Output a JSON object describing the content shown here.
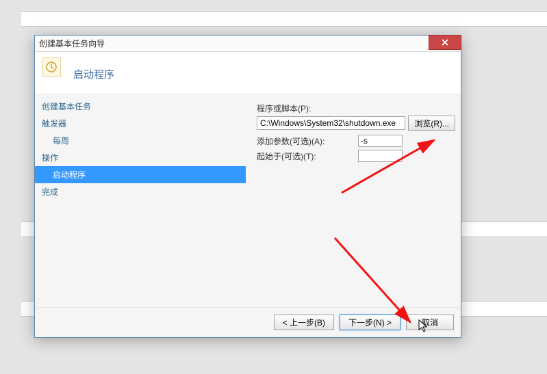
{
  "bg_bars": true,
  "dialog": {
    "title": "创建基本任务向导",
    "header_title": "启动程序",
    "close_btn": "×"
  },
  "sidebar": {
    "items": [
      {
        "label": "创建基本任务",
        "indent": false
      },
      {
        "label": "触发器",
        "indent": false
      },
      {
        "label": "每周",
        "indent": true
      },
      {
        "label": "操作",
        "indent": false
      },
      {
        "label": "启动程序",
        "indent": true,
        "selected": true
      },
      {
        "label": "完成",
        "indent": false
      }
    ]
  },
  "form": {
    "script_label": "程序或脚本(P):",
    "script_value": "C:\\Windows\\System32\\shutdown.exe",
    "browse_label": "浏览(R)...",
    "args_label": "添加参数(可选)(A):",
    "args_value": "-s",
    "startin_label": "起始于(可选)(T):",
    "startin_value": ""
  },
  "footer": {
    "back": "< 上一步(B)",
    "next": "下一步(N) >",
    "cancel": "取消"
  }
}
